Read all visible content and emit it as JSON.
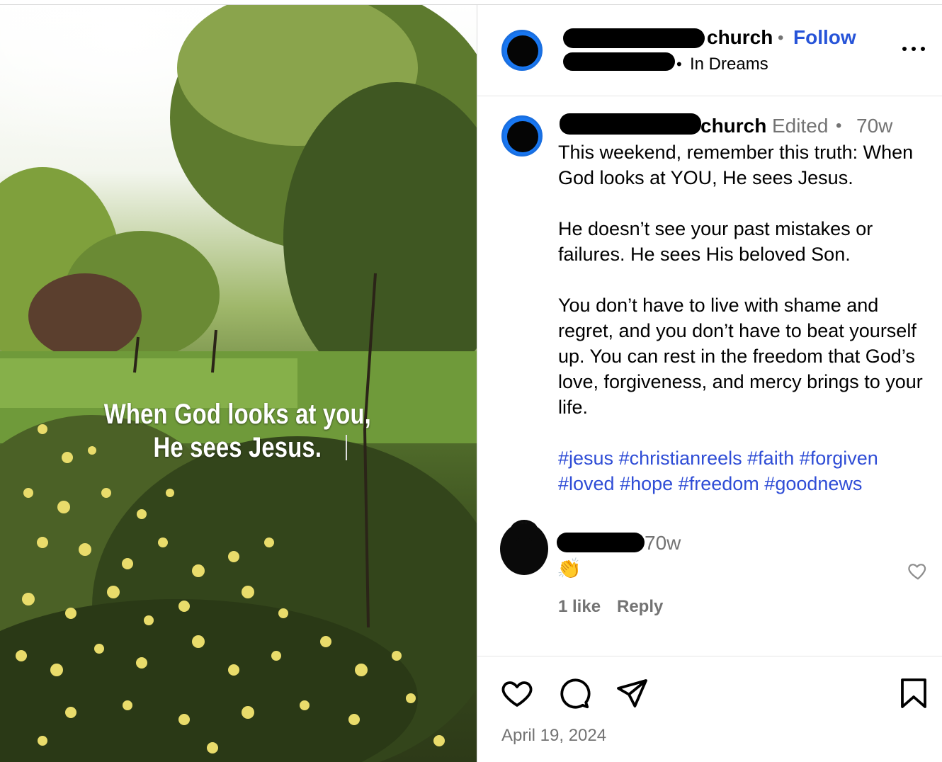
{
  "media": {
    "overlay_line1": "When God looks at you,",
    "overlay_line2": "He sees Jesus."
  },
  "header": {
    "username": "church",
    "follow_label": "Follow",
    "separator": "•",
    "location": "In Dreams"
  },
  "caption": {
    "username": "church",
    "edited_label": "Edited",
    "separator": "•",
    "time": "70w",
    "paragraphs": [
      "This weekend, remember this truth: When God looks at YOU, He sees Jesus.",
      "He doesn’t see your past mistakes or failures. He sees His beloved Son.",
      "You don’t have to live with shame and regret, and you don’t have to beat yourself up. You can rest in the freedom that God’s love, forgiveness, and mercy brings to your life."
    ],
    "hashtags": [
      "#jesus",
      "#christianreels",
      "#faith",
      "#forgiven",
      "#loved",
      "#hope",
      "#freedom",
      "#goodnews"
    ]
  },
  "comment": {
    "time": "70w",
    "text": "👏",
    "likes": "1 like",
    "reply_label": "Reply"
  },
  "footer": {
    "date": "April 19, 2024"
  },
  "colors": {
    "link_blue": "#2754d8",
    "hashtag_blue": "#2f4dd6",
    "muted": "#737373"
  }
}
